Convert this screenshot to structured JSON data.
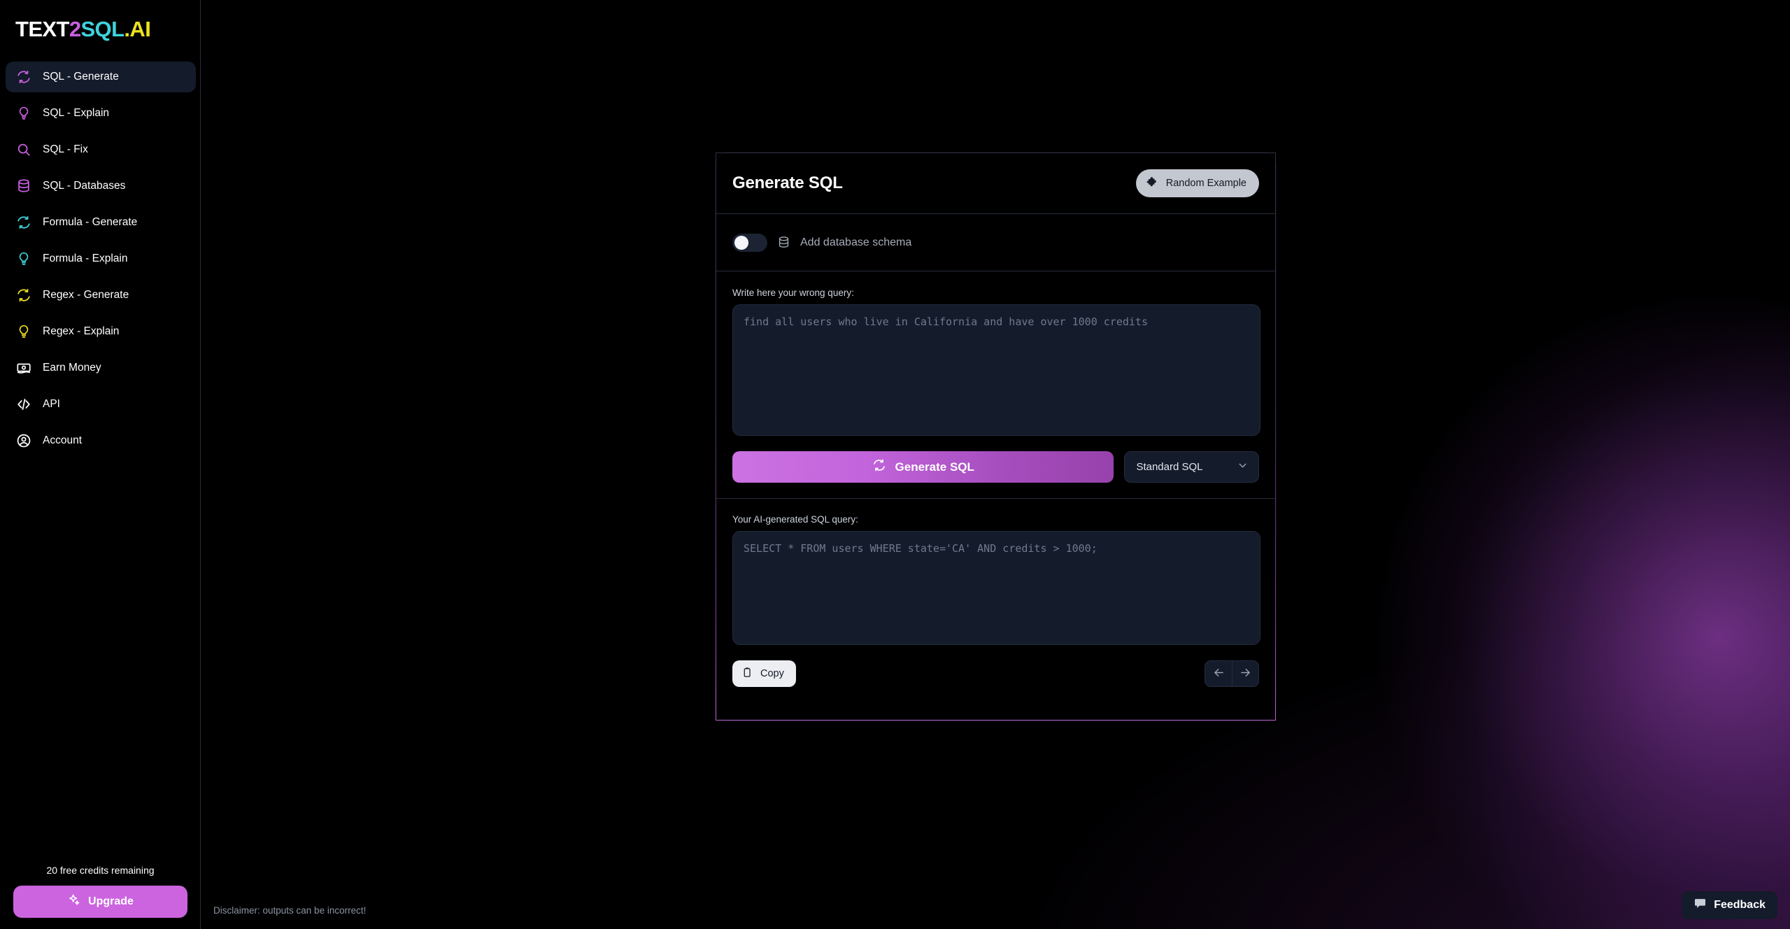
{
  "brand": {
    "part1": "TEXT",
    "part2": "2",
    "part3": "SQL",
    "part4": ".AI"
  },
  "sidebar": {
    "items": [
      {
        "label": "SQL - Generate",
        "icon": "refresh-icon",
        "color": "#c95fe0",
        "active": true
      },
      {
        "label": "SQL - Explain",
        "icon": "bulb-icon",
        "color": "#c95fe0",
        "active": false
      },
      {
        "label": "SQL - Fix",
        "icon": "search-icon",
        "color": "#c95fe0",
        "active": false
      },
      {
        "label": "SQL - Databases",
        "icon": "database-icon",
        "color": "#c95fe0",
        "active": false
      },
      {
        "label": "Formula - Generate",
        "icon": "refresh-icon",
        "color": "#3fd3dd",
        "active": false
      },
      {
        "label": "Formula - Explain",
        "icon": "bulb-icon",
        "color": "#3fd3dd",
        "active": false
      },
      {
        "label": "Regex - Generate",
        "icon": "refresh-icon",
        "color": "#ece11f",
        "active": false
      },
      {
        "label": "Regex - Explain",
        "icon": "bulb-icon",
        "color": "#ece11f",
        "active": false
      },
      {
        "label": "Earn Money",
        "icon": "money-icon",
        "color": "#ffffff",
        "active": false
      },
      {
        "label": "API",
        "icon": "code-icon",
        "color": "#ffffff",
        "active": false
      },
      {
        "label": "Account",
        "icon": "user-icon",
        "color": "#ffffff",
        "active": false
      }
    ],
    "credits_text": "20 free credits remaining",
    "upgrade_label": "Upgrade",
    "upgrade_icon": "sparkles-icon",
    "upgrade_color": "#cc64e0"
  },
  "card": {
    "title": "Generate SQL",
    "random_example_label": "Random Example",
    "random_example_icon": "puzzle-icon",
    "schema_label": "Add database schema",
    "schema_icon": "database-icon",
    "schema_toggle_on": false,
    "input_label": "Write here your wrong query:",
    "input_placeholder": "find all users who live in California and have over 1000 credits",
    "input_value": "",
    "generate_label": "Generate SQL",
    "generate_icon": "refresh-icon",
    "dialect_value": "Standard SQL",
    "dialect_icon": "chevron-down-icon",
    "output_label": "Your AI-generated SQL query:",
    "output_placeholder": "SELECT * FROM users WHERE state='CA' AND credits > 1000;",
    "output_value": "",
    "copy_label": "Copy",
    "copy_icon": "clipboard-icon",
    "prev_icon": "arrow-left-icon",
    "next_icon": "arrow-right-icon"
  },
  "footer": {
    "disclaimer": "Disclaimer: outputs can be incorrect!",
    "feedback_label": "Feedback",
    "feedback_icon": "chat-bubble-icon"
  },
  "theme": {
    "accent": "#cc64e0",
    "panel": "#141b2b",
    "background": "#000000"
  }
}
